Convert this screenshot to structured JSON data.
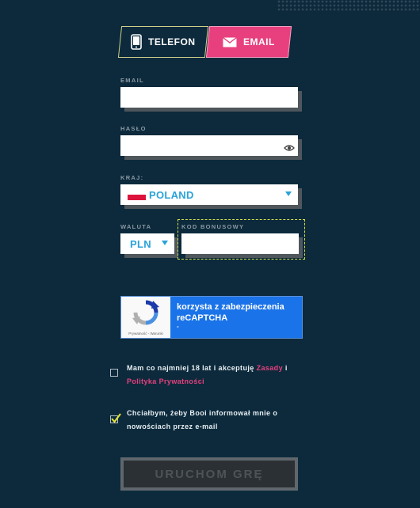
{
  "tabs": {
    "phone_label": "TELEFON",
    "email_label": "EMAIL"
  },
  "form": {
    "email_label": "EMAIL",
    "email_value": "",
    "password_label": "HASŁO",
    "password_value": "",
    "country_label": "KRAJ:",
    "country_value": "POLAND",
    "currency_label": "WALUTA",
    "currency_value": "PLN",
    "bonus_label": "KOD BONUSOWY",
    "bonus_value": ""
  },
  "captcha": {
    "line1": "korzysta z zabezpieczenia",
    "line2": "reCAPTCHA",
    "line3": "-",
    "logo_caption": "Prywatność - Warunki"
  },
  "consent": {
    "terms_prefix": "Mam co najmniej 18 lat i akceptuję ",
    "terms_link": "Zasady",
    "terms_and": " i",
    "privacy_link": "Polityka Prywatności",
    "terms_checked": false,
    "news_text_1": "Chciałbym, żeby Booi informował mnie o",
    "news_text_2": "nowościach przez e-mail",
    "news_checked": true
  },
  "submit": {
    "label": "URUCHOM GRĘ"
  },
  "colors": {
    "background": "#0c2a3c",
    "accent_pink": "#e8407e",
    "accent_blue": "#2aa3d9",
    "captcha_blue": "#1a73e8"
  }
}
